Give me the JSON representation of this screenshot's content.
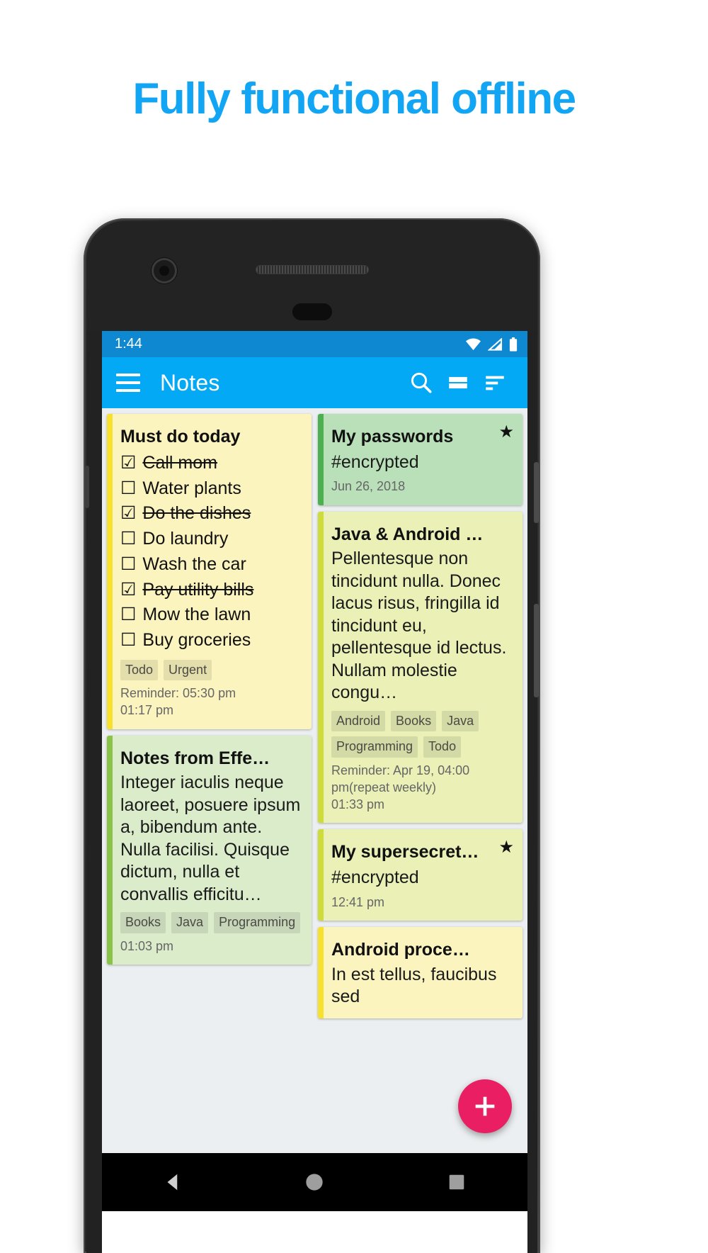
{
  "headline": "Fully functional offline",
  "brand_color": "#12a5f4",
  "phone": {
    "statusbar": {
      "time": "1:44",
      "icons": [
        "wifi-icon",
        "signal-icon",
        "battery-icon"
      ]
    },
    "appbar": {
      "menu_icon": "hamburger-menu-icon",
      "title": "Notes",
      "actions": [
        "search-icon",
        "view-layout-icon",
        "sort-icon"
      ]
    },
    "fab": {
      "icon": "plus-icon",
      "color": "#e91e63"
    },
    "navbar": {
      "back": "back-triangle-icon",
      "home": "home-circle-icon",
      "recents": "recents-square-icon"
    }
  },
  "notes": {
    "left": [
      {
        "title": "Must do today",
        "type": "checklist",
        "bg": "#fbf4bf",
        "stripe": "#f7e02e",
        "items": [
          {
            "text": "Call mom",
            "checked": true,
            "box": "☑"
          },
          {
            "text": "Water plants",
            "checked": false,
            "box": "☐"
          },
          {
            "text": "Do the dishes",
            "checked": true,
            "box": "☑"
          },
          {
            "text": "Do laundry",
            "checked": false,
            "box": "☐"
          },
          {
            "text": "Wash the car",
            "checked": false,
            "box": "☐"
          },
          {
            "text": "Pay utility bills",
            "checked": true,
            "box": "☑"
          },
          {
            "text": "Mow the lawn",
            "checked": false,
            "box": "☐"
          },
          {
            "text": "Buy groceries",
            "checked": false,
            "box": "☐"
          }
        ],
        "tags": [
          "Todo",
          "Urgent"
        ],
        "reminder": "Reminder: 05:30 pm",
        "date": "01:17 pm",
        "starred": false
      },
      {
        "title": "Notes from Effe…",
        "type": "text",
        "bg": "#dbeccb",
        "stripe": "#8bc34a",
        "body": "Integer iaculis neque laoreet, posuere ipsum a, bibendum ante. Nulla facilisi. Quisque dictum, nulla et convallis efficitu…",
        "tags": [
          "Books",
          "Java",
          "Programming"
        ],
        "date": "01:03 pm",
        "starred": false
      }
    ],
    "right": [
      {
        "title": "My passwords",
        "type": "text",
        "bg": "#b9e0b9",
        "stripe": "#4caf50",
        "body": "#encrypted",
        "tags": [],
        "date": "Jun 26, 2018",
        "starred": true,
        "star": "★"
      },
      {
        "title": "Java & Android …",
        "type": "text",
        "bg": "#eaf0b6",
        "stripe": "#cddc39",
        "body": "Pellentesque non tincidunt nulla. Donec lacus risus, fringilla id tincidunt eu, pellentesque id lectus. Nullam molestie congu…",
        "tags": [
          "Android",
          "Books",
          "Java",
          "Programming",
          "Todo"
        ],
        "reminder": "Reminder: Apr 19, 04:00 pm(repeat weekly)",
        "date": "01:33 pm",
        "starred": false
      },
      {
        "title": "My supersecret…",
        "type": "text",
        "bg": "#eaf0b6",
        "stripe": "#cddc39",
        "body": "#encrypted",
        "tags": [],
        "date": "12:41 pm",
        "starred": true,
        "star": "★"
      },
      {
        "title": "Android proce…",
        "type": "text",
        "bg": "#fbf4bf",
        "stripe": "#f7e02e",
        "body": "In est tellus, faucibus sed",
        "tags": [],
        "date": "",
        "starred": false
      }
    ]
  }
}
